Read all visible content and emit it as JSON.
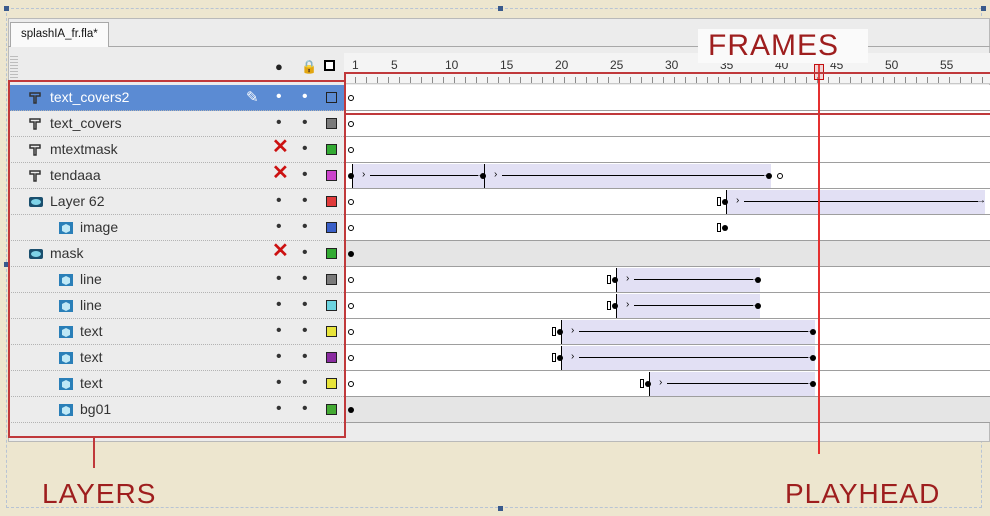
{
  "document_tab": "splashIA_fr.fla*",
  "header_icons": {
    "eye": "eye-icon",
    "lock": "lock-icon",
    "outline": "outline-icon"
  },
  "ruler_numbers": [
    "1",
    "5",
    "10",
    "15",
    "20",
    "25",
    "30",
    "35",
    "40",
    "45",
    "50",
    "55"
  ],
  "layers": [
    {
      "name": "text_covers2",
      "type": "mask",
      "selected": true,
      "visible": "•",
      "locked": "•",
      "color": "#2a5ab8",
      "editing": true
    },
    {
      "name": "text_covers",
      "type": "mask",
      "visible": "•",
      "locked": "•",
      "color": "#7a7a7a"
    },
    {
      "name": "mtextmask",
      "type": "mask",
      "visible": "✕",
      "locked": "•",
      "color": "#33aa33"
    },
    {
      "name": "tendaaa",
      "type": "mask",
      "visible": "✕",
      "locked": "•",
      "color": "#cc44cc"
    },
    {
      "name": "Layer 62",
      "type": "folder",
      "visible": "•",
      "locked": "•",
      "color": "#e03a3a"
    },
    {
      "name": "image",
      "type": "symbol",
      "indent": true,
      "visible": "•",
      "locked": "•",
      "color": "#3a5fc8"
    },
    {
      "name": "mask",
      "type": "folder",
      "visible": "✕",
      "locked": "•",
      "color": "#33aa33"
    },
    {
      "name": "line",
      "type": "symbol",
      "indent": true,
      "visible": "•",
      "locked": "•",
      "color": "#7a7a7a"
    },
    {
      "name": "line",
      "type": "symbol",
      "indent": true,
      "visible": "•",
      "locked": "•",
      "color": "#6cd4e0"
    },
    {
      "name": "text",
      "type": "symbol",
      "indent": true,
      "visible": "•",
      "locked": "•",
      "color": "#e8e43a"
    },
    {
      "name": "text",
      "type": "symbol",
      "indent": true,
      "visible": "•",
      "locked": "•",
      "color": "#8a2ba0"
    },
    {
      "name": "text",
      "type": "symbol",
      "indent": true,
      "visible": "•",
      "locked": "•",
      "color": "#e8e43a"
    },
    {
      "name": "bg01",
      "type": "symbol",
      "indent": true,
      "visible": "•",
      "locked": "•",
      "color": "#44aa33"
    }
  ],
  "annotations": {
    "frames": "FRAMES",
    "layers": "LAYERS",
    "playhead": "PLAYHEAD"
  }
}
